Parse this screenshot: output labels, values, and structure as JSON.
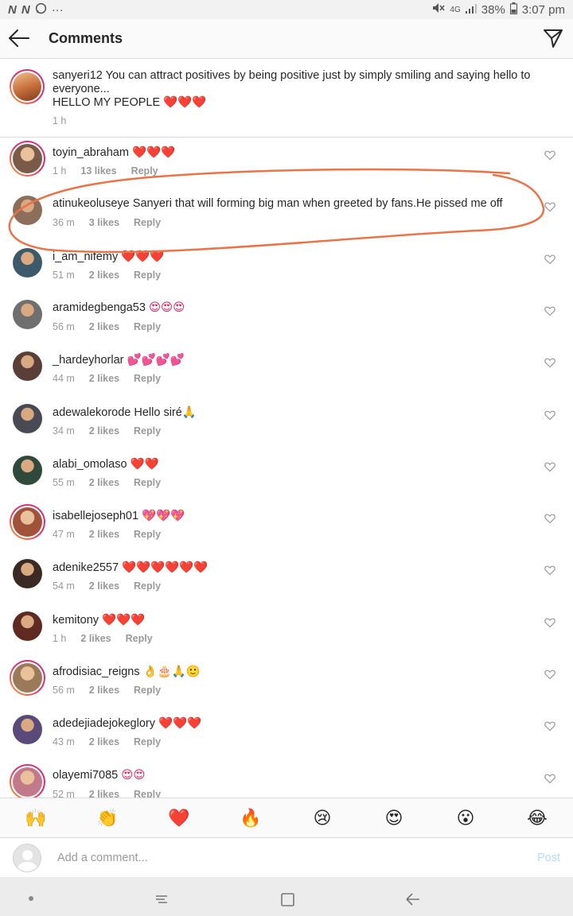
{
  "status_bar": {
    "left_icons": [
      "N",
      "N"
    ],
    "more": "···",
    "network": "4G",
    "battery": "38%",
    "time": "3:07 pm"
  },
  "header": {
    "title": "Comments"
  },
  "caption": {
    "username": "sanyeri12",
    "text": "You can attract positives by being positive just by simply smiling and saying hello to everyone...",
    "text2": "HELLO MY PEOPLE",
    "emoji": "❤️❤️❤️",
    "time": "1 h"
  },
  "comments": [
    {
      "user": "toyin_abraham",
      "text": "",
      "emoji": "❤️❤️❤️",
      "time": "1 h",
      "likes": "13 likes",
      "reply": "Reply"
    },
    {
      "user": "atinukeoluseye",
      "text": "Sanyeri that will forming big man when greeted by fans.He pissed me off",
      "emoji": "",
      "time": "36 m",
      "likes": "3 likes",
      "reply": "Reply"
    },
    {
      "user": "i_am_nifemy",
      "text": "",
      "emoji": "❤️❤️❤️",
      "time": "51 m",
      "likes": "2 likes",
      "reply": "Reply"
    },
    {
      "user": "aramidegbenga53",
      "text": "",
      "emoji": "😍😍😍",
      "time": "56 m",
      "likes": "2 likes",
      "reply": "Reply"
    },
    {
      "user": "_hardeyhorlar",
      "text": "",
      "emoji": "💕💕💕💕",
      "time": "44 m",
      "likes": "2 likes",
      "reply": "Reply"
    },
    {
      "user": "adewalekorode",
      "text": "Hello siré🙏",
      "emoji": "",
      "time": "34 m",
      "likes": "2 likes",
      "reply": "Reply"
    },
    {
      "user": "alabi_omolaso",
      "text": "",
      "emoji": "❤️❤️",
      "time": "55 m",
      "likes": "2 likes",
      "reply": "Reply"
    },
    {
      "user": "isabellejoseph01",
      "text": "",
      "emoji": "💖💖💖",
      "time": "47 m",
      "likes": "2 likes",
      "reply": "Reply"
    },
    {
      "user": "adenike2557",
      "text": "",
      "emoji": "❤️❤️❤️❤️❤️❤️",
      "time": "54 m",
      "likes": "2 likes",
      "reply": "Reply"
    },
    {
      "user": "kemitony",
      "text": "",
      "emoji": "❤️❤️❤️",
      "time": "1 h",
      "likes": "2 likes",
      "reply": "Reply"
    },
    {
      "user": "afrodisiac_reigns",
      "text": "",
      "emoji": "👌🎂🙏🙂",
      "time": "56 m",
      "likes": "2 likes",
      "reply": "Reply"
    },
    {
      "user": "adedejiadejokeglory",
      "text": "",
      "emoji": "❤️❤️❤️",
      "time": "43 m",
      "likes": "2 likes",
      "reply": "Reply"
    },
    {
      "user": "olayemi7085",
      "text": "",
      "emoji": "😍😍",
      "time": "52 m",
      "likes": "2 likes",
      "reply": "Reply"
    }
  ],
  "avatar_colors": [
    "#7a5a48",
    "#8d6e5a",
    "#3d5a6a",
    "#6f6f6f",
    "#5a3e38",
    "#4a4a55",
    "#2f4a3a",
    "#a0523a",
    "#3b2a24",
    "#5e2a22",
    "#9b7a5a",
    "#5a4a7a",
    "#c27a8a"
  ],
  "ringed_avatars": [
    0,
    7,
    10,
    12
  ],
  "reactions": [
    "🙌",
    "👏",
    "❤️",
    "🔥",
    "😢",
    "😍",
    "😮",
    "😂"
  ],
  "composer": {
    "placeholder": "Add a comment...",
    "post_label": "Post"
  },
  "colors": {
    "annotation": "#e8744a",
    "post_disabled": "#b3dbff"
  }
}
